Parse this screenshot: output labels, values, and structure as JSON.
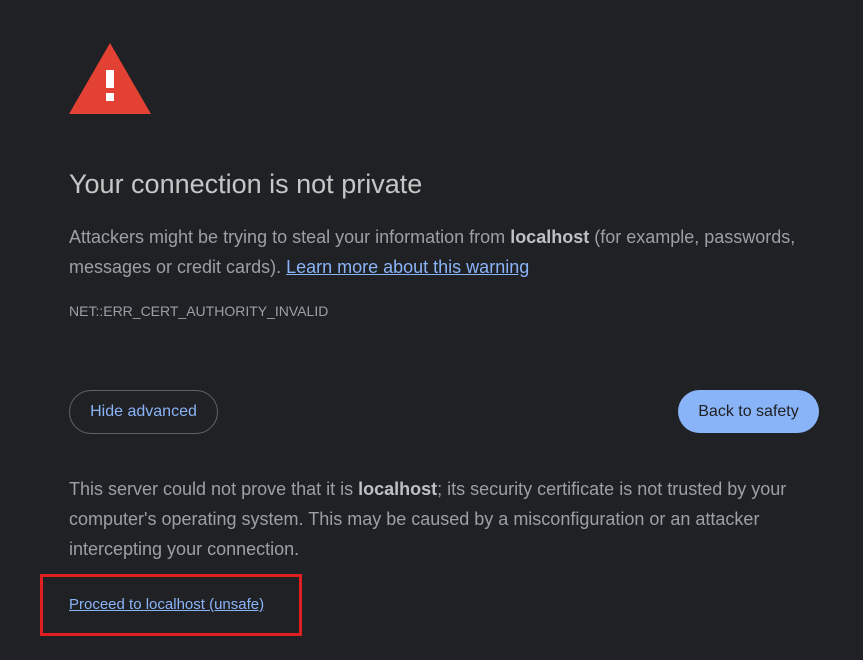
{
  "icon": {
    "name": "warning-triangle-icon",
    "color": "#e34133",
    "mark": "!"
  },
  "title": "Your connection is not private",
  "message": {
    "prefix": "Attackers might be trying to steal your information from ",
    "host": "localhost",
    "suffix": " (for example, passwords, messages or credit cards). ",
    "learn_more_link": "Learn more about this warning"
  },
  "error_code": "NET::ERR_CERT_AUTHORITY_INVALID",
  "buttons": {
    "hide_advanced": "Hide advanced",
    "back_to_safety": "Back to safety"
  },
  "details": {
    "prefix": "This server could not prove that it is ",
    "host": "localhost",
    "suffix": "; its security certificate is not trusted by your computer's operating system. This may be caused by a misconfiguration or an attacker intercepting your connection."
  },
  "proceed_link": "Proceed to localhost (unsafe)",
  "colors": {
    "background": "#202124",
    "link": "#8ab4f8",
    "primary_button": "#8ab4f8",
    "highlight_box": "#e02020"
  }
}
